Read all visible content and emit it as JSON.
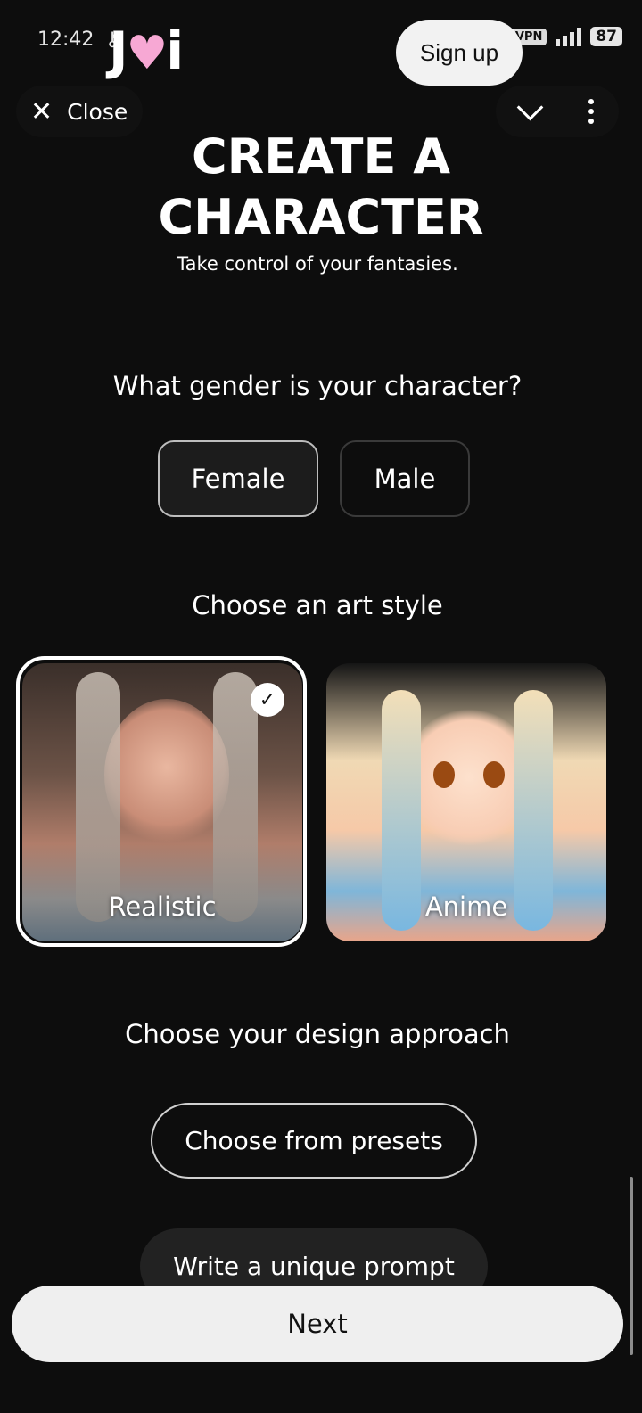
{
  "status_bar": {
    "time": "12:42",
    "vpn": "VPN",
    "battery": "87",
    "icons": [
      "key-icon",
      "search-icon",
      "alarm-icon",
      "mute-icon",
      "wifi-icon",
      "volte-icon",
      "signal-icon",
      "battery-icon"
    ]
  },
  "header": {
    "logo_left": "J",
    "logo_right": "i",
    "sign_up": "Sign up",
    "close": "Close"
  },
  "page": {
    "title_line1": "CREATE A",
    "title_line2": "CHARACTER",
    "subtitle": "Take control of your fantasies."
  },
  "gender": {
    "question": "What gender is your character?",
    "options": [
      "Female",
      "Male"
    ],
    "selected": "Female"
  },
  "art_style": {
    "question": "Choose an art style",
    "options": [
      "Realistic",
      "Anime"
    ],
    "selected": "Realistic"
  },
  "design": {
    "question": "Choose your design approach",
    "preset_button": "Choose from presets",
    "prompt_button": "Write a unique prompt"
  },
  "footer": {
    "next": "Next"
  },
  "colors": {
    "background": "#0d0d0d",
    "logo_heart": "#f7a8d4",
    "button_light": "#efefef"
  }
}
